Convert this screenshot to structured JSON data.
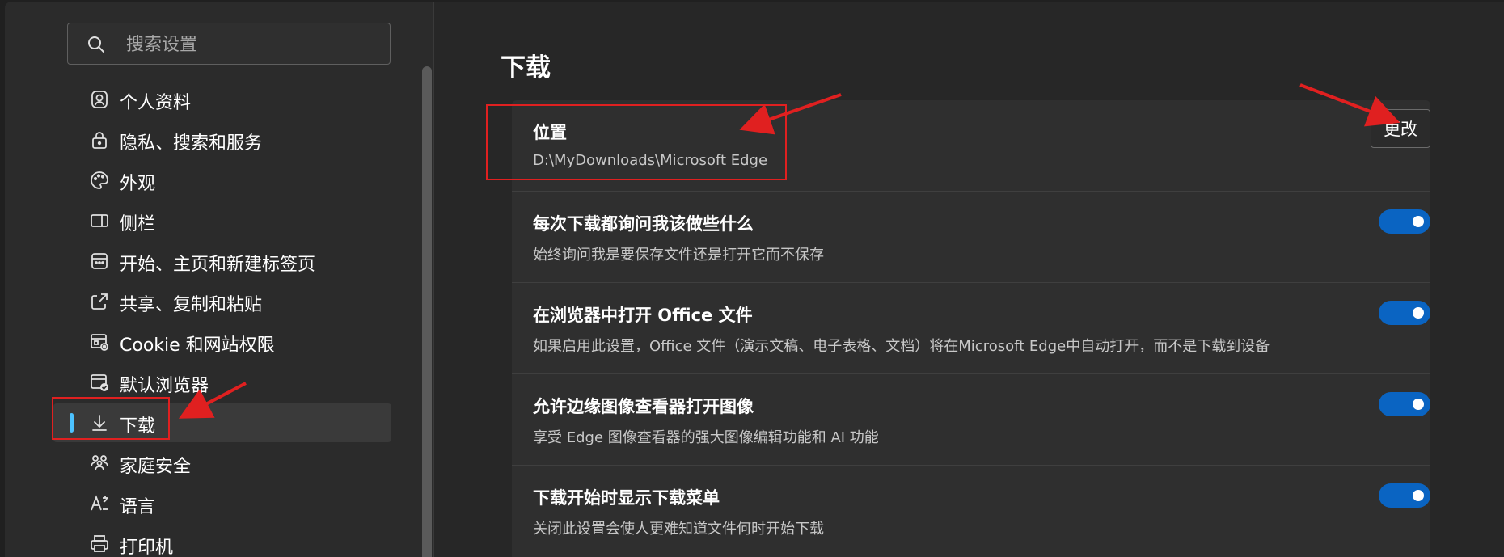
{
  "search": {
    "placeholder": "搜索设置"
  },
  "sidebar": {
    "items": [
      {
        "label": "个人资料",
        "icon": "profile-icon"
      },
      {
        "label": "隐私、搜索和服务",
        "icon": "lock-icon"
      },
      {
        "label": "外观",
        "icon": "palette-icon"
      },
      {
        "label": "侧栏",
        "icon": "sidebar-icon"
      },
      {
        "label": "开始、主页和新建标签页",
        "icon": "home-tabs-icon"
      },
      {
        "label": "共享、复制和粘贴",
        "icon": "share-icon"
      },
      {
        "label": "Cookie 和网站权限",
        "icon": "site-permissions-icon"
      },
      {
        "label": "默认浏览器",
        "icon": "default-browser-icon"
      },
      {
        "label": "下载",
        "icon": "download-icon",
        "active": true
      },
      {
        "label": "家庭安全",
        "icon": "family-icon"
      },
      {
        "label": "语言",
        "icon": "language-icon"
      },
      {
        "label": "打印机",
        "icon": "printer-icon"
      }
    ]
  },
  "main": {
    "title": "下载",
    "location": {
      "title": "位置",
      "path": "D:\\MyDownloads\\Microsoft Edge",
      "change_label": "更改"
    },
    "settings": [
      {
        "title": "每次下载都询问我该做些什么",
        "desc": "始终询问我是要保存文件还是打开它而不保存",
        "enabled": true
      },
      {
        "title": "在浏览器中打开 Office 文件",
        "desc": "如果启用此设置，Office 文件（演示文稿、电子表格、文档）将在Microsoft Edge中自动打开，而不是下载到设备",
        "enabled": true
      },
      {
        "title": "允许边缘图像查看器打开图像",
        "desc": "享受 Edge 图像查看器的强大图像编辑功能和 AI 功能",
        "enabled": true
      },
      {
        "title": "下载开始时显示下载菜单",
        "desc": "关闭此设置会使人更难知道文件何时开始下载",
        "enabled": true
      }
    ]
  },
  "colors": {
    "accent": "#4cc2ff",
    "toggle_on": "#0a64c2",
    "annotation": "#e02020"
  }
}
